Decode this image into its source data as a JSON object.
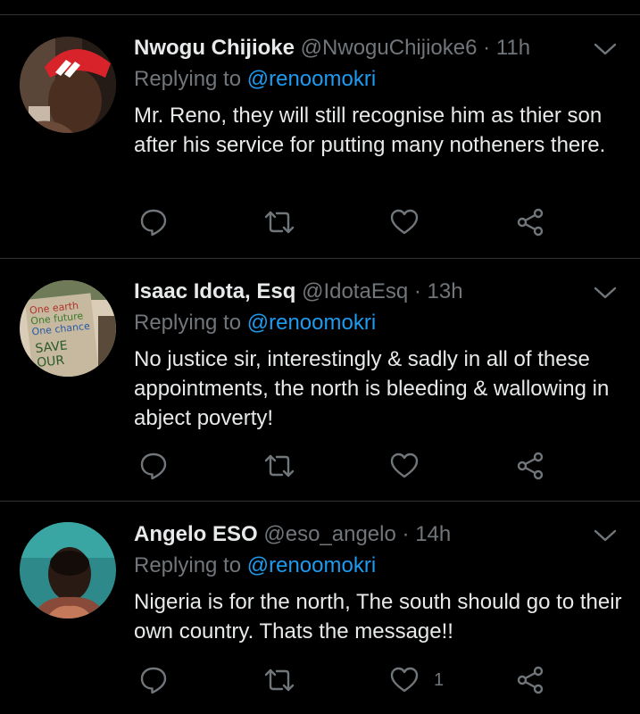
{
  "tweets": [
    {
      "name": "Nwogu Chijioke",
      "handle": "@NwoguChijioke6",
      "dot": "·",
      "time": "11h",
      "replying_label": "Replying to",
      "replying_to": "@renoomokri",
      "text": "Mr. Reno, they will still recognise him as thier son after his service for putting many notheners there.",
      "like_count": "",
      "avatar_lettering": "adidas"
    },
    {
      "name": "Isaac Idota, Esq",
      "handle": "@IdotaEsq",
      "dot": "·",
      "time": "13h",
      "replying_label": "Replying to",
      "replying_to": "@renoomokri",
      "text": "No justice sir, interestingly & sadly in all of these appointments, the north is bleeding & wallowing in abject poverty!",
      "like_count": "",
      "avatar_lettering": "One earth One future One chance SAVE OUR FUTURE"
    },
    {
      "name": "Angelo ESO",
      "handle": "@eso_angelo",
      "dot": "·",
      "time": "14h",
      "replying_label": "Replying to",
      "replying_to": "@renoomokri",
      "text": "Nigeria is for the north, The south should go to their own country. Thats the message!!",
      "like_count": "1",
      "avatar_lettering": ""
    }
  ],
  "icons": {
    "reply": "reply-icon",
    "retweet": "retweet-icon",
    "like": "heart-icon",
    "share": "share-icon",
    "more": "chevron-down-icon"
  },
  "colors": {
    "background": "#000000",
    "text": "#e7e9ea",
    "muted": "#71767b",
    "link": "#1d9bf0",
    "divider": "#2f3336"
  }
}
